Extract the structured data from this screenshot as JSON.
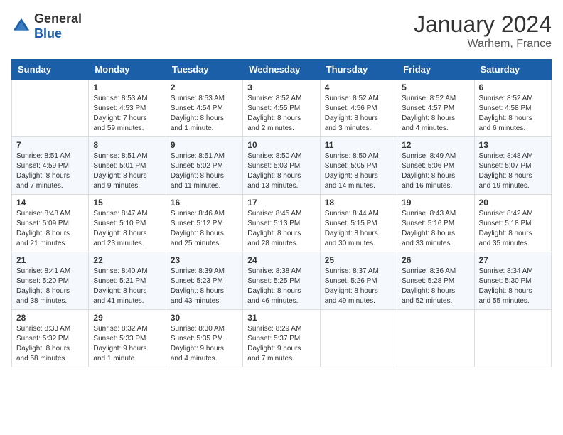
{
  "logo": {
    "general": "General",
    "blue": "Blue"
  },
  "title": {
    "month_year": "January 2024",
    "location": "Warhem, France"
  },
  "days_header": [
    "Sunday",
    "Monday",
    "Tuesday",
    "Wednesday",
    "Thursday",
    "Friday",
    "Saturday"
  ],
  "weeks": [
    [
      {
        "day": "",
        "info": ""
      },
      {
        "day": "1",
        "info": "Sunrise: 8:53 AM\nSunset: 4:53 PM\nDaylight: 7 hours\nand 59 minutes."
      },
      {
        "day": "2",
        "info": "Sunrise: 8:53 AM\nSunset: 4:54 PM\nDaylight: 8 hours\nand 1 minute."
      },
      {
        "day": "3",
        "info": "Sunrise: 8:52 AM\nSunset: 4:55 PM\nDaylight: 8 hours\nand 2 minutes."
      },
      {
        "day": "4",
        "info": "Sunrise: 8:52 AM\nSunset: 4:56 PM\nDaylight: 8 hours\nand 3 minutes."
      },
      {
        "day": "5",
        "info": "Sunrise: 8:52 AM\nSunset: 4:57 PM\nDaylight: 8 hours\nand 4 minutes."
      },
      {
        "day": "6",
        "info": "Sunrise: 8:52 AM\nSunset: 4:58 PM\nDaylight: 8 hours\nand 6 minutes."
      }
    ],
    [
      {
        "day": "7",
        "info": "Sunrise: 8:51 AM\nSunset: 4:59 PM\nDaylight: 8 hours\nand 7 minutes."
      },
      {
        "day": "8",
        "info": "Sunrise: 8:51 AM\nSunset: 5:01 PM\nDaylight: 8 hours\nand 9 minutes."
      },
      {
        "day": "9",
        "info": "Sunrise: 8:51 AM\nSunset: 5:02 PM\nDaylight: 8 hours\nand 11 minutes."
      },
      {
        "day": "10",
        "info": "Sunrise: 8:50 AM\nSunset: 5:03 PM\nDaylight: 8 hours\nand 13 minutes."
      },
      {
        "day": "11",
        "info": "Sunrise: 8:50 AM\nSunset: 5:05 PM\nDaylight: 8 hours\nand 14 minutes."
      },
      {
        "day": "12",
        "info": "Sunrise: 8:49 AM\nSunset: 5:06 PM\nDaylight: 8 hours\nand 16 minutes."
      },
      {
        "day": "13",
        "info": "Sunrise: 8:48 AM\nSunset: 5:07 PM\nDaylight: 8 hours\nand 19 minutes."
      }
    ],
    [
      {
        "day": "14",
        "info": "Sunrise: 8:48 AM\nSunset: 5:09 PM\nDaylight: 8 hours\nand 21 minutes."
      },
      {
        "day": "15",
        "info": "Sunrise: 8:47 AM\nSunset: 5:10 PM\nDaylight: 8 hours\nand 23 minutes."
      },
      {
        "day": "16",
        "info": "Sunrise: 8:46 AM\nSunset: 5:12 PM\nDaylight: 8 hours\nand 25 minutes."
      },
      {
        "day": "17",
        "info": "Sunrise: 8:45 AM\nSunset: 5:13 PM\nDaylight: 8 hours\nand 28 minutes."
      },
      {
        "day": "18",
        "info": "Sunrise: 8:44 AM\nSunset: 5:15 PM\nDaylight: 8 hours\nand 30 minutes."
      },
      {
        "day": "19",
        "info": "Sunrise: 8:43 AM\nSunset: 5:16 PM\nDaylight: 8 hours\nand 33 minutes."
      },
      {
        "day": "20",
        "info": "Sunrise: 8:42 AM\nSunset: 5:18 PM\nDaylight: 8 hours\nand 35 minutes."
      }
    ],
    [
      {
        "day": "21",
        "info": "Sunrise: 8:41 AM\nSunset: 5:20 PM\nDaylight: 8 hours\nand 38 minutes."
      },
      {
        "day": "22",
        "info": "Sunrise: 8:40 AM\nSunset: 5:21 PM\nDaylight: 8 hours\nand 41 minutes."
      },
      {
        "day": "23",
        "info": "Sunrise: 8:39 AM\nSunset: 5:23 PM\nDaylight: 8 hours\nand 43 minutes."
      },
      {
        "day": "24",
        "info": "Sunrise: 8:38 AM\nSunset: 5:25 PM\nDaylight: 8 hours\nand 46 minutes."
      },
      {
        "day": "25",
        "info": "Sunrise: 8:37 AM\nSunset: 5:26 PM\nDaylight: 8 hours\nand 49 minutes."
      },
      {
        "day": "26",
        "info": "Sunrise: 8:36 AM\nSunset: 5:28 PM\nDaylight: 8 hours\nand 52 minutes."
      },
      {
        "day": "27",
        "info": "Sunrise: 8:34 AM\nSunset: 5:30 PM\nDaylight: 8 hours\nand 55 minutes."
      }
    ],
    [
      {
        "day": "28",
        "info": "Sunrise: 8:33 AM\nSunset: 5:32 PM\nDaylight: 8 hours\nand 58 minutes."
      },
      {
        "day": "29",
        "info": "Sunrise: 8:32 AM\nSunset: 5:33 PM\nDaylight: 9 hours\nand 1 minute."
      },
      {
        "day": "30",
        "info": "Sunrise: 8:30 AM\nSunset: 5:35 PM\nDaylight: 9 hours\nand 4 minutes."
      },
      {
        "day": "31",
        "info": "Sunrise: 8:29 AM\nSunset: 5:37 PM\nDaylight: 9 hours\nand 7 minutes."
      },
      {
        "day": "",
        "info": ""
      },
      {
        "day": "",
        "info": ""
      },
      {
        "day": "",
        "info": ""
      }
    ]
  ]
}
